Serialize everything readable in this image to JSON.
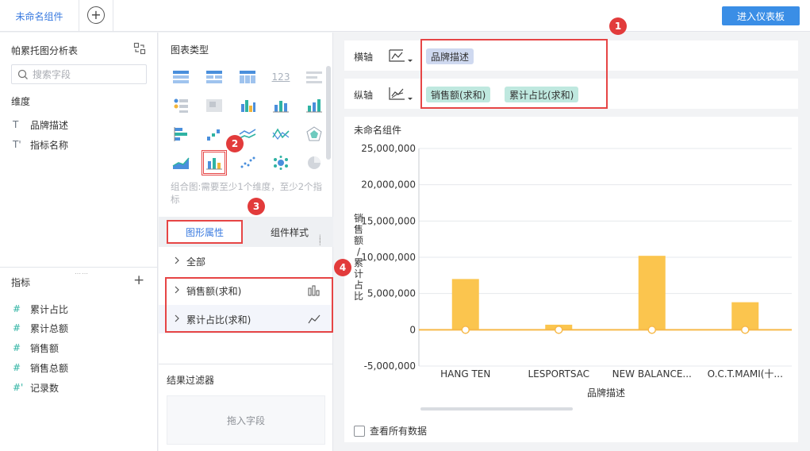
{
  "tabs": {
    "active_tab": "未命名组件",
    "add_tab_symbol": "+"
  },
  "toolbar": {
    "enter_dashboard": "进入仪表板"
  },
  "left_panel": {
    "title": "帕累托图分析表",
    "search_placeholder": "搜索字段",
    "dimensions_label": "维度",
    "dimensions": [
      {
        "icon": "T",
        "label": "品牌描述"
      },
      {
        "icon": "T'",
        "label": "指标名称"
      }
    ],
    "metrics_label": "指标",
    "metrics": [
      {
        "icon": "#",
        "label": "累计占比"
      },
      {
        "icon": "#",
        "label": "累计总额"
      },
      {
        "icon": "#",
        "label": "销售额"
      },
      {
        "icon": "#",
        "label": "销售总额"
      },
      {
        "icon": "#'",
        "label": "记录数"
      }
    ]
  },
  "middle_panel": {
    "chart_type_label": "图表类型",
    "hint": "组合图:需要至少1个维度，至少2个指标",
    "prop_tabs": {
      "graph_props": "图形属性",
      "component_style": "组件样式"
    },
    "prop_rows": [
      {
        "label": "全部"
      },
      {
        "label": "销售额(求和)",
        "icon": "bar-chart-icon"
      },
      {
        "label": "累计占比(求和)",
        "icon": "line-chart-icon"
      }
    ],
    "filter_title": "结果过滤器",
    "filter_drop": "拖入字段"
  },
  "axes": {
    "x_label": "横轴",
    "y_label": "纵轴",
    "x_fields": [
      "品牌描述"
    ],
    "y_fields": [
      "销售额(求和)",
      "累计占比(求和)"
    ]
  },
  "chart_card": {
    "title": "未命名组件",
    "show_all": "查看所有数据"
  },
  "badges": [
    "1",
    "2",
    "3",
    "4"
  ],
  "colors": {
    "accent": "#3a8ee6",
    "bar": "#fbc54e",
    "highlight_red": "#e64545"
  },
  "chart_data": {
    "type": "bar",
    "categories": [
      "HANG TEN",
      "LESPORTSAC",
      "NEW BALANCE...",
      "O.C.T.MAMI(十..."
    ],
    "series": [
      {
        "name": "销售额(求和)",
        "type": "bar",
        "values": [
          7000000,
          700000,
          10200000,
          3800000
        ]
      },
      {
        "name": "累计占比(求和)",
        "type": "line",
        "values": [
          0,
          0,
          0,
          0
        ]
      }
    ],
    "xlabel": "品牌描述",
    "ylabel": "销售额/累计占比",
    "yticks": [
      "25,000,000",
      "20,000,000",
      "15,000,000",
      "10,000,000",
      "5,000,000",
      "0",
      "-5,000,000"
    ],
    "ylim": [
      -5000000,
      25000000
    ]
  }
}
